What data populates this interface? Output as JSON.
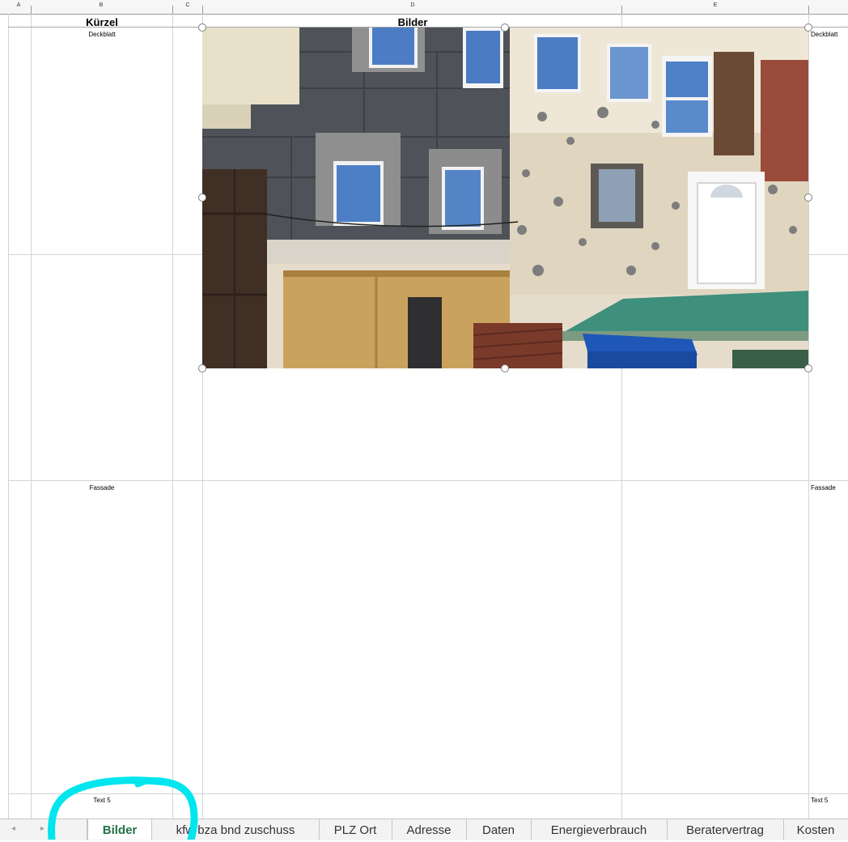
{
  "columns": [
    "A",
    "B",
    "C",
    "D",
    "E"
  ],
  "header": {
    "kuerzel": "Kürzel",
    "bilder": "Bilder"
  },
  "rows": {
    "row1": {
      "left": "Deckblatt",
      "right": "Deckblatt"
    },
    "row2": {
      "left": "Fassade",
      "right": "Fassade"
    },
    "row3": {
      "left": "Text 5",
      "right": "Text 5"
    }
  },
  "image": {
    "description_icon": "building-facade-photo"
  },
  "tabs": [
    {
      "label": "Bilder",
      "active": true
    },
    {
      "label": "kfw bza bnd zuschuss",
      "active": false
    },
    {
      "label": "PLZ Ort",
      "active": false
    },
    {
      "label": "Adresse",
      "active": false
    },
    {
      "label": "Daten",
      "active": false
    },
    {
      "label": "Energieverbrauch",
      "active": false
    },
    {
      "label": "Beratervertrag",
      "active": false
    },
    {
      "label": "Kosten",
      "active": false
    }
  ],
  "nav": {
    "prev": "◂",
    "next": "▸"
  },
  "colors": {
    "active_tab": "#217346",
    "annotation": "#00e5ee"
  }
}
